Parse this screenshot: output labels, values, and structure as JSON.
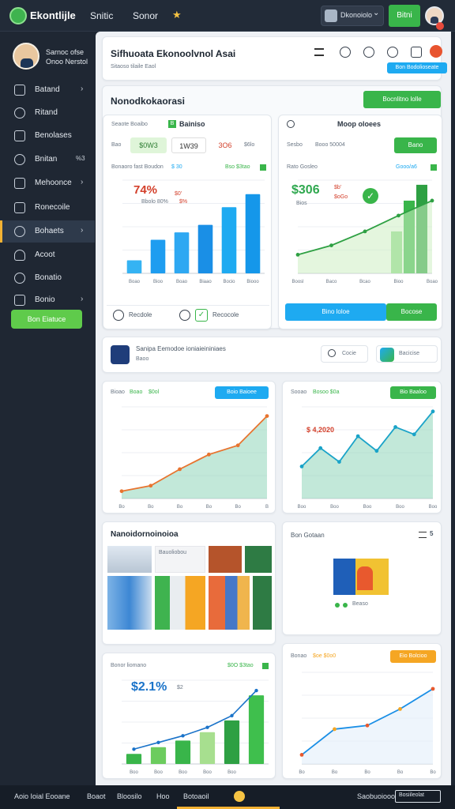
{
  "topbar": {
    "brand": "Ekontlijle",
    "tab1": "Snitic",
    "tab2": "Sonor",
    "account": "Dkonoiolo",
    "green_btn": "Bitni",
    "star": "★",
    "chevron": "⌄"
  },
  "sidebar": {
    "profile_line1": "Sarnoc ofse",
    "profile_line2": "Onoo Nerstol",
    "items": [
      {
        "label": "Batand",
        "icon": "wallet-icon",
        "chev": "›"
      },
      {
        "label": "Ritand",
        "icon": "chat-icon",
        "chev": ""
      },
      {
        "label": "Benolases",
        "icon": "document-icon",
        "chev": ""
      },
      {
        "label": "Bnitan",
        "icon": "search-icon",
        "count": "%3"
      },
      {
        "label": "Mehoonce",
        "icon": "calendar-icon",
        "chev": "›"
      },
      {
        "label": "Ronecoile",
        "icon": "folder-icon",
        "chev": ""
      },
      {
        "label": "Bohaets",
        "icon": "clock-icon",
        "chev": "›"
      },
      {
        "label": "Acoot",
        "icon": "user-icon",
        "chev": ""
      },
      {
        "label": "Bonatio",
        "icon": "bell-icon",
        "chev": ""
      },
      {
        "label": "Bonio",
        "icon": "archive-icon",
        "chev": "›"
      }
    ],
    "cta": "Bon Eiatuce"
  },
  "header": {
    "title": "Sifhuoata Ekonoolvnol Asai",
    "subtitle": "Sitaoso tilaile Eaol",
    "action": "Bon Bodolioseate"
  },
  "section1": {
    "title": "Nonodkokaorasi",
    "button": "Bocnlitno lolle"
  },
  "panel_left": {
    "tabs_label": "Seaote Boaibo",
    "tab_active": "Bainiso",
    "badge": "B",
    "row_label": "Bao",
    "stat1": "$0W3",
    "stat2": "1W39",
    "stat3": "3O6",
    "stat4": "$6lo",
    "chart_title": "Bonaoro fast Boudon",
    "chart_value": "$ 30",
    "chart_tag": "Bso $3tao",
    "big_value": "74%",
    "small1": "$0'",
    "small2": "Bbolo 80%",
    "small3": "$%",
    "foot_left": "Recdole",
    "foot_right": "Recocole"
  },
  "panel_right": {
    "tabs_label": "Moop oloees",
    "row_label": "Sesbo",
    "row_value": "Booo 50004",
    "button": "Bano",
    "chart_title": "Rato Gosleo",
    "chart_tag": "Gooo/a6",
    "big_value": "$306",
    "small1": "$b'",
    "small2": "$oGo",
    "small3": "Bios",
    "btn_blue": "Bino loloe",
    "btn_green": "Bocose",
    "foot": "Sono Dioo"
  },
  "section2": {
    "title": "Sanipa Eemodoe ioniaieininiaes",
    "subtitle": "Baoo",
    "btn1": "Cocie",
    "btn2": "Bacicise"
  },
  "chart_a": {
    "title": "Bioao",
    "tag1": "Boao",
    "tag2": "$0ol",
    "button": "Boio Baioee",
    "legend": "$ao"
  },
  "chart_b": {
    "title": "Sooao",
    "tag": "Bosoo $0a",
    "button": "Bio Baaloo",
    "badge": "$ 4,2020"
  },
  "gallery": {
    "title": "Nanoidornoinoioa",
    "inner_label": "Bauoliobou"
  },
  "side_card": {
    "title": "Bon Gotaan",
    "icon": "menu-icon",
    "label": "Beaso"
  },
  "chart_c": {
    "title": "Bonor liomano",
    "tag": "$0O $3tao",
    "big_value": "$2.1%",
    "small": "$2"
  },
  "chart_d": {
    "title": "Bonao",
    "tag": "$oe $0o0",
    "button": "Eio Bolcioo"
  },
  "footer": {
    "items": [
      "Aoio Ioial Eooane",
      "Boaot",
      "Bloosilo",
      "Hoo",
      "Botoaoil",
      "Saobuoiooo",
      "Bosiileolat"
    ]
  },
  "colors": {
    "green": "#39b54a",
    "blue": "#1eaaf1",
    "orange": "#f5a623",
    "teal_area": "#8fd6b9",
    "dark_bg": "#1f2733"
  },
  "chart_data": [
    {
      "type": "bar",
      "categories": [
        "Boao",
        "Bioo",
        "Boao",
        "Biaao",
        "Bocio",
        "Biooo"
      ],
      "values": [
        14,
        36,
        44,
        52,
        71,
        85
      ],
      "xlabel": "",
      "ylabel": "",
      "ylim": [
        0,
        100
      ]
    },
    {
      "type": "area",
      "categories": [
        "Boosl",
        "Baco",
        "Bcao",
        "Bioo",
        "Boao"
      ],
      "values": [
        20,
        30,
        45,
        62,
        78
      ],
      "xlabel": "",
      "ylabel": "",
      "ylim": [
        0,
        100
      ]
    },
    {
      "type": "area",
      "categories": [
        "Bo",
        "Bo",
        "Bo",
        "Bo",
        "Bo",
        "B"
      ],
      "values": [
        8,
        14,
        32,
        48,
        58,
        90
      ],
      "ylim": [
        0,
        100
      ]
    },
    {
      "type": "area",
      "categories": [
        "Boo",
        "Boo",
        "Boo",
        "Boo",
        "Boo"
      ],
      "values": [
        35,
        55,
        40,
        68,
        52,
        78,
        70,
        95
      ],
      "ylim": [
        0,
        100
      ]
    },
    {
      "type": "bar",
      "categories": [
        "Boo",
        "Boo",
        "Boo",
        "Boo",
        "Boo"
      ],
      "values": [
        12,
        20,
        28,
        38,
        52,
        82
      ],
      "ylim": [
        0,
        100
      ]
    },
    {
      "type": "line",
      "categories": [
        "Bo",
        "Bo",
        "Bo",
        "Bo",
        "Bo"
      ],
      "values": [
        10,
        38,
        42,
        60,
        82
      ],
      "ylim": [
        0,
        100
      ]
    }
  ]
}
